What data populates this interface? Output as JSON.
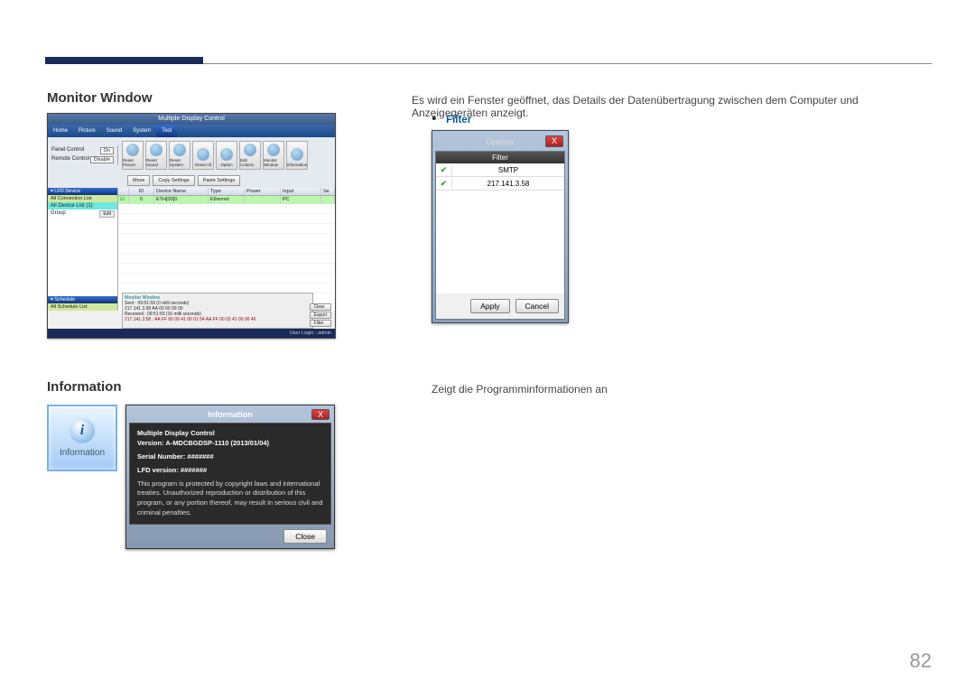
{
  "page_number": "82",
  "section1": {
    "title": "Monitor Window",
    "description": "Es wird ein Fenster geöffnet, das Details der Datenübertragung zwischen dem Computer und Anzeigegeräten anzeigt.",
    "sub_bullet": "Filter"
  },
  "mdc": {
    "window_title": "Multiple Display Control",
    "menu": [
      "Home",
      "Picture",
      "Sound",
      "System",
      "Tool"
    ],
    "active_menu": "Tool",
    "toolbar_left": {
      "row1_label": "Panel Control",
      "row1_value": "On",
      "row2_label": "Remote Control",
      "row2_value": "Disable"
    },
    "toolbar_buttons": [
      "Reset Picture",
      "Reset Sound",
      "Reset System",
      "Reset All",
      "Option",
      "Edit Column",
      "Monitor Window",
      "Information"
    ],
    "toolbar2": [
      "Move",
      "Copy Settings",
      "Paste Settings"
    ],
    "side": {
      "h1": "LFD Device",
      "row1": "All Connection List",
      "row2": "All Device List (1)",
      "group": "Group",
      "edit": "Edit",
      "h2": "Schedule",
      "sch_row": "All Schedule List"
    },
    "table": {
      "headers": [
        "",
        "ID",
        "Device Name",
        "Type",
        "Power",
        "Input",
        "Se"
      ],
      "row": [
        "",
        "0",
        "ETH[00]0",
        "Ethernet",
        "",
        "PC",
        ""
      ]
    },
    "log": {
      "title": "Monitor Window",
      "l1": "Sent : 09:51:59 (0 milli seconds)",
      "l2": "217.141.3.58 AA 00 00 00 00",
      "l3": "Received : 09:51:59 (16 milli seconds)",
      "l4": "217.141.3.58 : AA FF 00 09 41 00 01 54 AA FF 00 03 41 00 00 46",
      "buttons": [
        "Clear",
        "Export",
        "Filter"
      ]
    },
    "footer": "User Login : admin"
  },
  "filter_dialog": {
    "title": "Options",
    "subtitle": "Filter",
    "rows": [
      "SMTP",
      "217.141.3.58"
    ],
    "apply": "Apply",
    "cancel": "Cancel",
    "close": "X"
  },
  "section2": {
    "title": "Information",
    "description": "Zeigt die Programminformationen an"
  },
  "info_tile_label": "Information",
  "info_dialog": {
    "title": "Information",
    "close": "X",
    "line1": "Multiple Display Control",
    "line2": "Version: A-MDCBGDSP-1110 (2013/01/04)",
    "line3": "Serial Number: #######",
    "line4": "LFD version: #######",
    "line5": "This program is protected by copyright laws and international treaties. Unauthorized reproduction or distribution of this program, or any portion thereof, may result in serious civil and criminal penalties.",
    "close_btn": "Close"
  }
}
